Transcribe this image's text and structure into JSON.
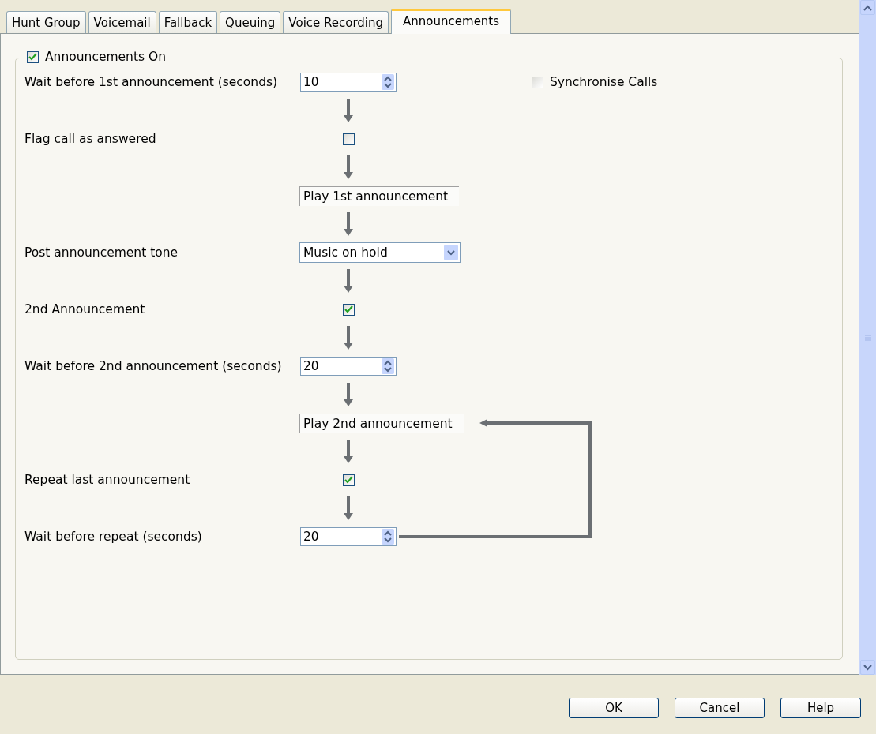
{
  "tabs": [
    {
      "label": "Hunt Group",
      "selected": false
    },
    {
      "label": "Voicemail",
      "selected": false
    },
    {
      "label": "Fallback",
      "selected": false
    },
    {
      "label": "Queuing",
      "selected": false
    },
    {
      "label": "Voice Recording",
      "selected": false
    },
    {
      "label": "Announcements",
      "selected": true
    }
  ],
  "group": {
    "label": "Announcements On",
    "checked": true
  },
  "synchronise_calls": {
    "label": "Synchronise Calls",
    "checked": false
  },
  "steps": [
    {
      "kind": "spin",
      "label": "Wait before 1st announcement (seconds)",
      "value": "10"
    },
    {
      "kind": "check",
      "label": "Flag call as answered",
      "checked": false
    },
    {
      "kind": "action",
      "text": "Play 1st announcement"
    },
    {
      "kind": "dropdown",
      "label": "Post announcement tone",
      "value": "Music on hold"
    },
    {
      "kind": "check",
      "label": "2nd Announcement",
      "checked": true
    },
    {
      "kind": "spin",
      "label": "Wait before 2nd announcement (seconds)",
      "value": "20"
    },
    {
      "kind": "action",
      "text": "Play 2nd announcement"
    },
    {
      "kind": "check",
      "label": "Repeat last announcement",
      "checked": true
    },
    {
      "kind": "spin",
      "label": "Wait before repeat (seconds)",
      "value": "20"
    }
  ],
  "buttons": [
    "OK",
    "Cancel",
    "Help"
  ]
}
